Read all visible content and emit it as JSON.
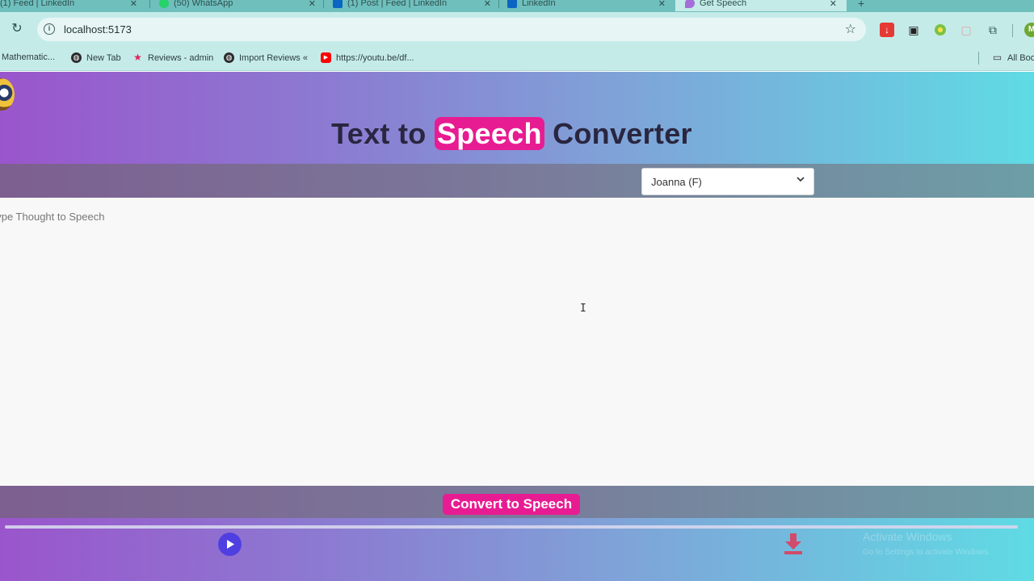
{
  "browser": {
    "tabs": [
      {
        "label": "(1) Feed | LinkedIn"
      },
      {
        "label": "(50) WhatsApp"
      },
      {
        "label": "(1) Post | Feed | LinkedIn"
      },
      {
        "label": "LinkedIn"
      },
      {
        "label": "Get Speech"
      }
    ],
    "url": "localhost:5173",
    "profile_initial": "M"
  },
  "bookmarks": [
    {
      "label": "Mathematic...",
      "icon": "bookmark-icon"
    },
    {
      "label": "New Tab",
      "icon": "globe-icon"
    },
    {
      "label": "Reviews - admin",
      "icon": "star-icon"
    },
    {
      "label": "Import Reviews «",
      "icon": "globe-icon"
    },
    {
      "label": "https://youtu.be/df...",
      "icon": "youtube-icon"
    },
    {
      "label": "All Boo",
      "icon": "folder-icon"
    }
  ],
  "app": {
    "title_before": "Text to",
    "title_highlight": "Speech",
    "title_after": "Converter",
    "voice_selected": "Joanna (F)",
    "text_placeholder": "Type Thought to Speech",
    "convert_label": "Convert to Speech",
    "watermark_line1": "Activate Windows",
    "watermark_line2": "Go to Settings to activate Windows."
  },
  "colors": {
    "accent": "#e81c92",
    "play": "#4f3fe0",
    "download": "#d14b6a",
    "gradient_start": "#9a55cc",
    "gradient_end": "#5fdbe4"
  }
}
